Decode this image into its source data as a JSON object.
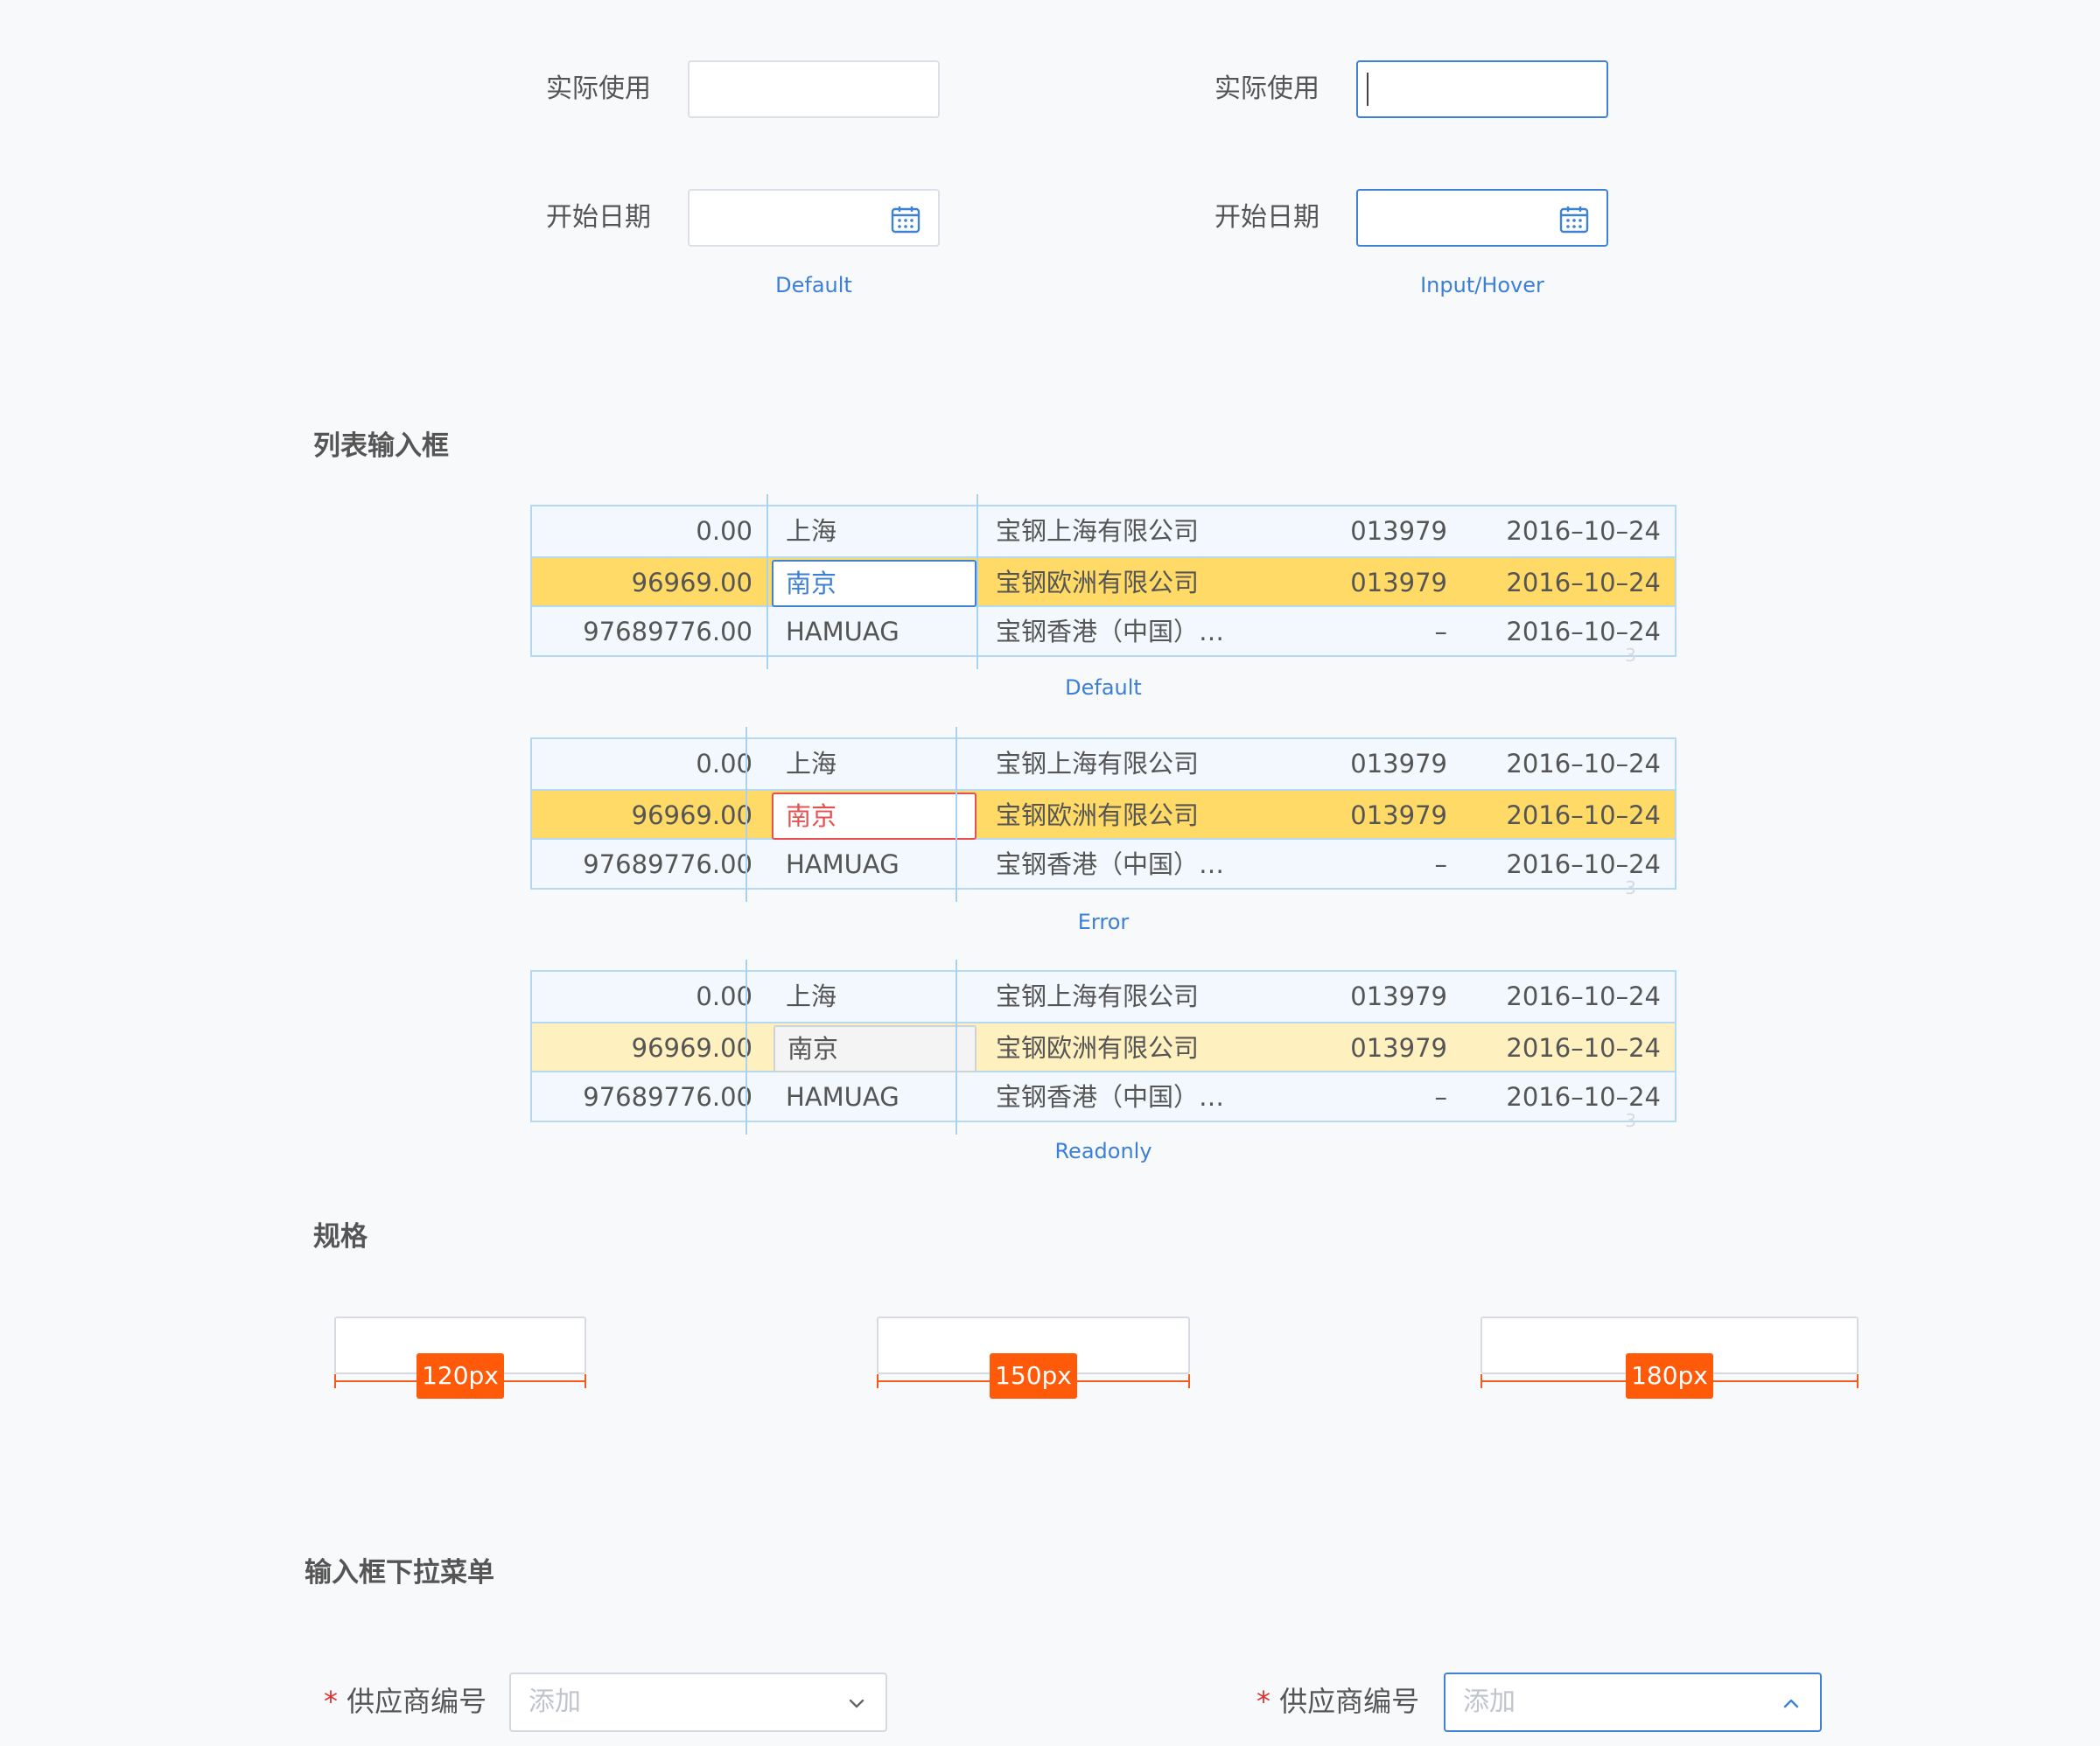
{
  "form_states": {
    "left": {
      "field1_label": "实际使用",
      "field2_label": "开始日期",
      "caption": "Default"
    },
    "right": {
      "field1_label": "实际使用",
      "field2_label": "开始日期",
      "caption": "Input/Hover"
    },
    "calendar_icon": "calendar-icon"
  },
  "list_section": {
    "title": "列表输入框",
    "tables": [
      {
        "caption": "Default",
        "rows": [
          {
            "amount": "0.00",
            "city": "上海",
            "company": "宝钢上海有限公司",
            "code": "013979",
            "date": "2016–10–24"
          },
          {
            "amount": "96969.00",
            "city": "南京",
            "company": "宝钢欧洲有限公司",
            "code": "013979",
            "date": "2016–10–24"
          },
          {
            "amount": "97689776.00",
            "city": "HAMUAG",
            "company": "宝钢香港（中国）…",
            "code": "–",
            "date": "2016–10–24"
          }
        ]
      },
      {
        "caption": "Error",
        "rows": [
          {
            "amount": "0.00",
            "city": "上海",
            "company": "宝钢上海有限公司",
            "code": "013979",
            "date": "2016–10–24"
          },
          {
            "amount": "96969.00",
            "city": "南京",
            "company": "宝钢欧洲有限公司",
            "code": "013979",
            "date": "2016–10–24"
          },
          {
            "amount": "97689776.00",
            "city": "HAMUAG",
            "company": "宝钢香港（中国）…",
            "code": "–",
            "date": "2016–10–24"
          }
        ]
      },
      {
        "caption": "Readonly",
        "rows": [
          {
            "amount": "0.00",
            "city": "上海",
            "company": "宝钢上海有限公司",
            "code": "013979",
            "date": "2016–10–24"
          },
          {
            "amount": "96969.00",
            "city": "南京",
            "company": "宝钢欧洲有限公司",
            "code": "013979",
            "date": "2016–10–24"
          },
          {
            "amount": "97689776.00",
            "city": "HAMUAG",
            "company": "宝钢香港（中国）…",
            "code": "–",
            "date": "2016–10–24"
          }
        ]
      }
    ],
    "ghost_char": "3",
    "colors": {
      "highlight": "#ffda66",
      "highlight_light": "#fff0bf",
      "border": "#b6d9f2",
      "active": "#3f82d1",
      "error": "#e8504f"
    }
  },
  "spec_section": {
    "title": "规格",
    "sizes": [
      "120px",
      "150px",
      "180px"
    ],
    "accent": "#ff5a0a"
  },
  "dropdown_section": {
    "title": "输入框下拉菜单",
    "required_mark": "*",
    "label": "供应商编号",
    "placeholder": "添加",
    "closed_icon": "chevron-down-icon",
    "open_icon": "chevron-up-icon"
  }
}
